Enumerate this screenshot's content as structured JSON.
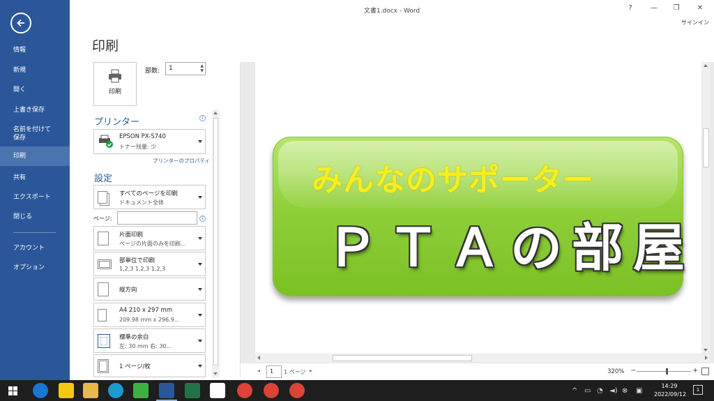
{
  "window": {
    "title": "文書1.docx - Word",
    "help": "?",
    "minimize": "—",
    "restore": "❐",
    "close": "✕",
    "signin": "サインイン"
  },
  "nav": {
    "items": [
      {
        "label": "情報"
      },
      {
        "label": "新規"
      },
      {
        "label": "開く"
      },
      {
        "label": "上書き保存"
      },
      {
        "label": "名前を付けて"
      },
      {
        "label": "保存"
      },
      {
        "label": "印刷",
        "active": true
      },
      {
        "label": "共有"
      },
      {
        "label": "エクスポート"
      },
      {
        "label": "閉じる"
      },
      {
        "label": "アカウント"
      },
      {
        "label": "オプション"
      }
    ]
  },
  "print": {
    "title": "印刷",
    "button_label": "印刷",
    "copies_label": "部数:",
    "copies_value": "1",
    "printer_heading": "プリンター",
    "printer_name": "EPSON PX-S740",
    "printer_status": "トナー残量: 少",
    "printer_properties": "プリンターのプロパティ",
    "settings_heading": "設定",
    "pages_range": {
      "line1": "すべてのページを印刷",
      "line2": "ドキュメント全体"
    },
    "pages_label": "ページ:",
    "pages_value": "",
    "sides": {
      "line1": "片面印刷",
      "line2": "ページの片面のみを印刷..."
    },
    "collation": {
      "line1": "部単位で印刷",
      "line2": "1,2,3    1,2,3    1,2,3"
    },
    "orientation": {
      "line1": "縦方向"
    },
    "paper": {
      "line1": "A4 210 x 297 mm",
      "line2": "209.98 mm x 296.9..."
    },
    "margins": {
      "line1": "標準の余白",
      "line2": "左:  30 mm    右:  30..."
    },
    "per_sheet": {
      "line1": "1 ページ/枚"
    },
    "info_icon": "i"
  },
  "preview": {
    "banner_subtitle": "みんなのサポーター",
    "banner_title": "ＰＴＡの部屋",
    "page_current": "1",
    "page_total": "1 ページ",
    "zoom_pct": "320%",
    "zoom_level": 0.52
  },
  "taskbar": {
    "time": "14:29",
    "date": "2022/09/12",
    "notification_count": "1"
  },
  "colors": {
    "accent": "#2b579a",
    "banner_green": "#8fcf3a",
    "banner_yellow": "#f5ef1e"
  }
}
